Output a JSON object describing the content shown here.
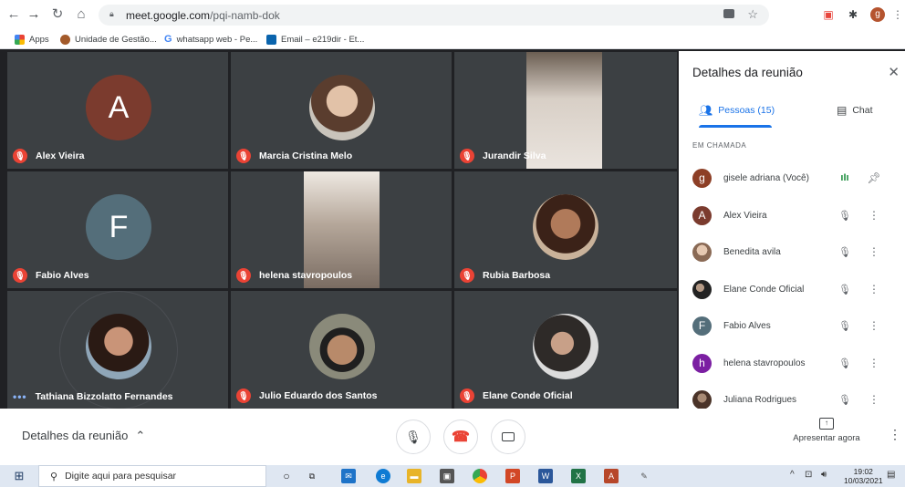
{
  "browser": {
    "url_domain": "meet.google.com",
    "url_path": "/pqi-namb-dok",
    "profile_letter": "g",
    "bookmarks": [
      {
        "label": "Apps",
        "color": "#e8453c"
      },
      {
        "label": "Unidade de Gestão...",
        "color": "#a35a2a"
      },
      {
        "label": "whatsapp web - Pe...",
        "color": "#4285f4"
      },
      {
        "label": "Email – e219dir - Et...",
        "color": "#0a64ad"
      }
    ]
  },
  "tiles": [
    {
      "name": "Alex Vieira",
      "kind": "letter",
      "letter": "A",
      "avatar_color": "#7b3b2e",
      "muted": true
    },
    {
      "name": "Marcia Cristina Melo",
      "kind": "photo",
      "avatar_color": "#8a6b5c",
      "muted": true
    },
    {
      "name": "Jurandir Silva",
      "kind": "video",
      "avatar_color": "#a59a90",
      "muted": true
    },
    {
      "name": "Fabio Alves",
      "kind": "letter",
      "letter": "F",
      "avatar_color": "#546e7a",
      "muted": true
    },
    {
      "name": "helena stavropoulos",
      "kind": "video",
      "avatar_color": "#b8a89c",
      "muted": true
    },
    {
      "name": "Rubia Barbosa",
      "kind": "photo",
      "avatar_color": "#7b4a3a",
      "muted": true
    },
    {
      "name": "Tathiana Bizzolatto Fernandes",
      "kind": "photo",
      "avatar_color": "#6a3c45",
      "muted": false
    },
    {
      "name": "Julio Eduardo dos Santos",
      "kind": "photo",
      "avatar_color": "#6b5a4c",
      "muted": true
    },
    {
      "name": "Elane Conde Oficial",
      "kind": "photo",
      "avatar_color": "#5a5a5a",
      "muted": true
    }
  ],
  "panel": {
    "title": "Detalhes da reunião",
    "tab_people": "Pessoas (15)",
    "tab_chat": "Chat",
    "section": "EM CHAMADA",
    "people": [
      {
        "name": "gisele adriana (Você)",
        "letter": "g",
        "color": "#8d3f26",
        "state": "speaking"
      },
      {
        "name": "Alex Vieira",
        "letter": "A",
        "color": "#7b3b2e",
        "state": "muted"
      },
      {
        "name": "Benedita avila",
        "letter": "",
        "color": "#c7a78f",
        "state": "muted"
      },
      {
        "name": "Elane Conde Oficial",
        "letter": "",
        "color": "#3d3d3d",
        "state": "muted"
      },
      {
        "name": "Fabio Alves",
        "letter": "F",
        "color": "#546e7a",
        "state": "muted"
      },
      {
        "name": "helena stavropoulos",
        "letter": "h",
        "color": "#7b1fa2",
        "state": "muted"
      },
      {
        "name": "Juliana Rodrigues",
        "letter": "",
        "color": "#6b4f3f",
        "state": "muted"
      }
    ]
  },
  "bottom": {
    "title": "Detalhes da reunião",
    "present_label": "Apresentar agora"
  },
  "taskbar": {
    "search_placeholder": "Digite aqui para pesquisar",
    "time": "19:02",
    "date": "10/03/2021"
  }
}
